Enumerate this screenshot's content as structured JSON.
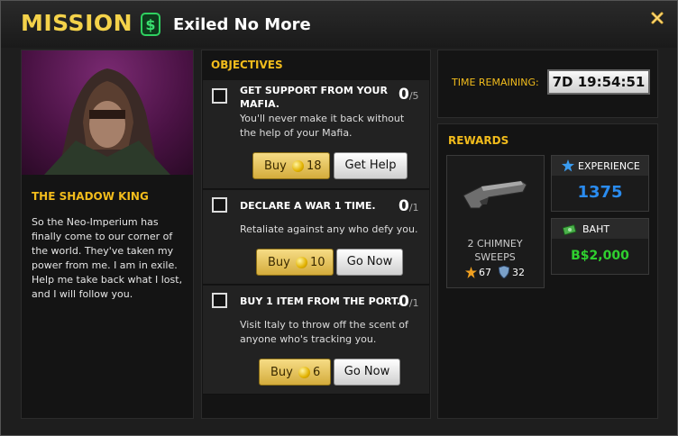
{
  "header": {
    "mission_word": "MISSION :",
    "mission_name": "Exiled No More"
  },
  "character": {
    "name": "THE SHADOW KING",
    "text": "So the Neo-Imperium has finally come to our corner of the world. They've taken my power from me. I am in exile. Help me take back what I lost, and I will follow you."
  },
  "objectives": {
    "title": "OBJECTIVES",
    "items": [
      {
        "title": "GET SUPPORT FROM YOUR MAFIA.",
        "desc": "You'll never make it back without the help of your Mafia.",
        "done": "0",
        "total": "/5",
        "buy_label": "Buy",
        "buy_cost": "18",
        "action": "Get Help"
      },
      {
        "title": "DECLARE A WAR 1 TIME.",
        "desc": "Retaliate against any who defy you.",
        "done": "0",
        "total": "/1",
        "buy_label": "Buy",
        "buy_cost": "10",
        "action": "Go Now"
      },
      {
        "title": "BUY 1 ITEM FROM THE PORT.",
        "desc": "Visit Italy to throw off the scent of anyone who's tracking you.",
        "done": "0",
        "total": "/1",
        "buy_label": "Buy",
        "buy_cost": "6",
        "action": "Go Now"
      }
    ]
  },
  "timer": {
    "label": "TIME REMAINING:",
    "value": "7D 19:54:51"
  },
  "rewards": {
    "title": "REWARDS",
    "item": {
      "name": "2 CHIMNEY SWEEPS",
      "attack": "67",
      "defense": "32"
    },
    "experience": {
      "label": "EXPERIENCE",
      "value": "1375"
    },
    "baht": {
      "label": "BAHT",
      "value": "B$2,000"
    }
  },
  "colors": {
    "accent": "#f2bc1c",
    "experience": "#2a8cf0",
    "baht": "#2fd02f"
  }
}
